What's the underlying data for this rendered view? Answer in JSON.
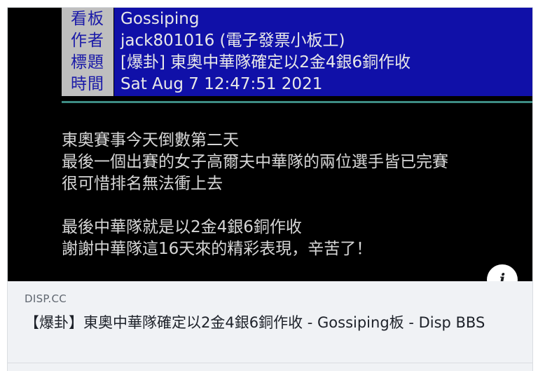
{
  "post_header": {
    "rows": [
      {
        "label": "看板",
        "value": "Gossiping"
      },
      {
        "label": "作者",
        "value": "jack801016 (電子發票小板工)"
      },
      {
        "label": "標題",
        "value": "[爆卦] 東奧中華隊確定以2金4銀6銅作收"
      },
      {
        "label": "時間",
        "value": "Sat Aug  7 12:47:51 2021"
      }
    ]
  },
  "post_body": {
    "lines": [
      "東奧賽事今天倒數第二天",
      "最後一個出賽的女子高爾夫中華隊的兩位選手皆已完賽",
      "很可惜排名無法衝上去",
      "",
      "最後中華隊就是以2金4銀6銅作收",
      "謝謝中華隊這16天來的精彩表現，辛苦了！"
    ]
  },
  "info_button": {
    "icon": "info-icon",
    "glyph": "i"
  },
  "link_meta": {
    "domain": "DISP.CC",
    "title": "【爆卦】東奧中華隊確定以2金4銀6銅作收 - Gossiping板 - Disp BBS"
  },
  "colors": {
    "header_label_bg": "#bfbfbf",
    "header_label_text": "#1a1aa8",
    "header_value_bg": "#1010a8",
    "header_value_text": "#e8e8e8",
    "separator": "#3d8c84",
    "preview_bg": "#000000",
    "meta_bg": "#f0f2f5"
  }
}
